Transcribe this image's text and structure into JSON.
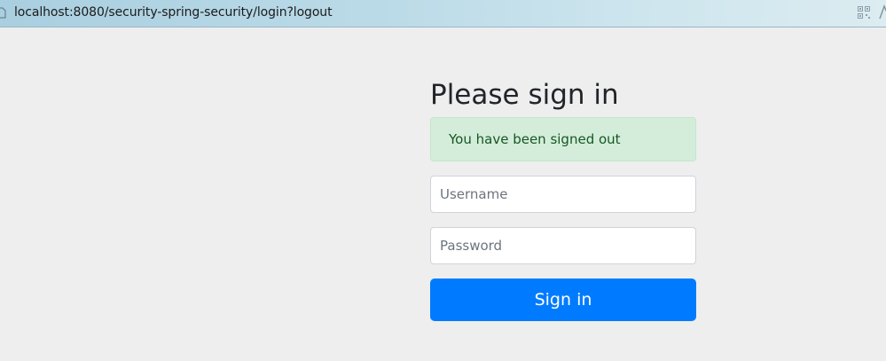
{
  "browser": {
    "url": "localhost:8080/security-spring-security/login?logout",
    "icons": [
      "page-icon",
      "qr-code-icon",
      "browser-icon"
    ]
  },
  "login": {
    "heading": "Please sign in",
    "alert": "You have been signed out",
    "username_placeholder": "Username",
    "password_placeholder": "Password",
    "submit_label": "Sign in"
  },
  "colors": {
    "page_bg": "#eeeeee",
    "alert_bg": "#d4edda",
    "alert_text": "#155724",
    "button_bg": "#007bff",
    "button_text": "#ffffff"
  }
}
